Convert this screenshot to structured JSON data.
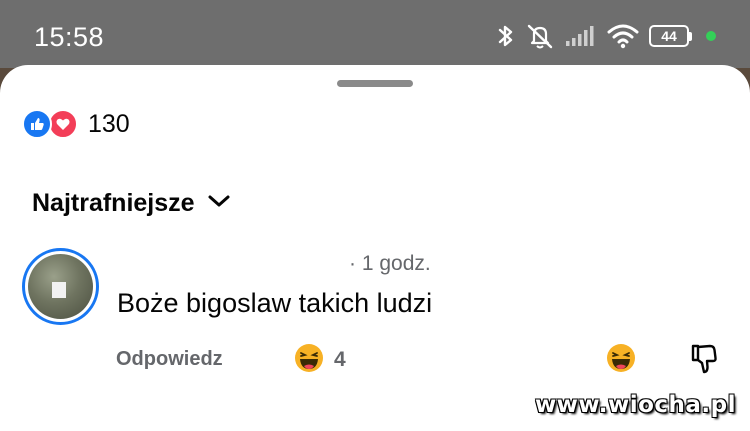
{
  "status_bar": {
    "time": "15:58",
    "battery_level": "44",
    "icons": [
      "bluetooth-icon",
      "mute-icon",
      "cellular-signal-icon",
      "wifi-icon",
      "battery-icon",
      "charging-dot-icon"
    ],
    "charging_color": "#34d058"
  },
  "reactions": {
    "icons": [
      "like-icon",
      "love-icon"
    ],
    "count": "130",
    "like_color": "#1877f2",
    "love_color": "#f33e58"
  },
  "sort": {
    "label": "Najtrafniejsze",
    "icon": "chevron-down-icon"
  },
  "comment": {
    "time": "· 1 godz.",
    "text": "Boże bigoslaw takich ludzi",
    "reply_label": "Odpowiedz",
    "reaction_icon": "haha-icon",
    "reaction_count": "4",
    "action_icons": [
      "haha-icon",
      "thumbs-down-icon"
    ]
  },
  "watermark": "www.wiocha.pl"
}
